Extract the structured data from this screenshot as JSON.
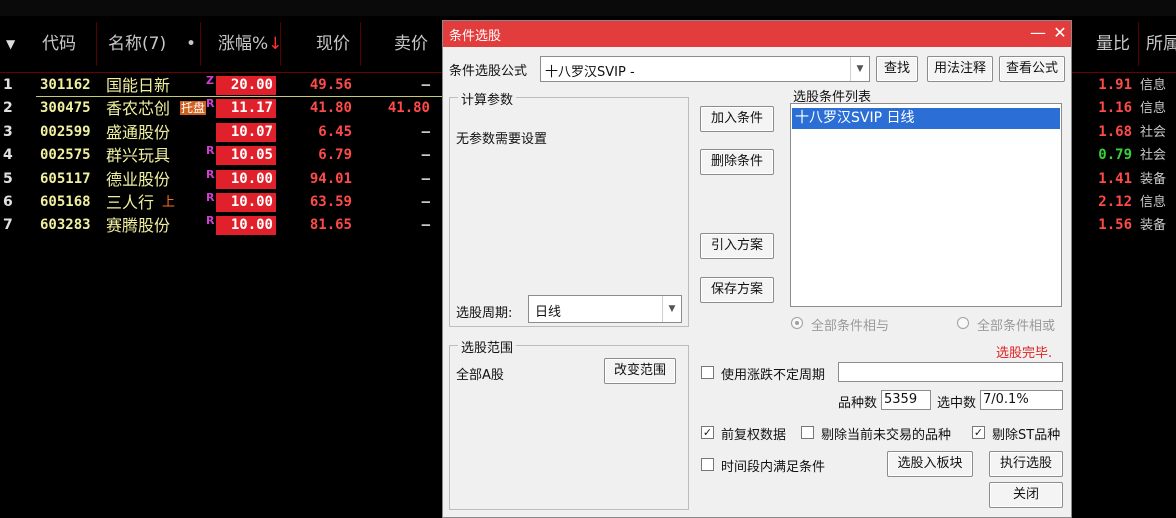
{
  "grid": {
    "headers": {
      "code": "代码",
      "name": "名称(7)",
      "dot": "•",
      "pct": "涨幅%",
      "pct_arrow": "↓",
      "price": "现价",
      "ask": "卖价",
      "vol_ratio": "量比",
      "industry": "所属"
    },
    "rows": [
      {
        "n": "1",
        "code": "301162",
        "name": "国能日新",
        "mark": "Z",
        "pct": "20.00",
        "price": "49.56",
        "ask": "—",
        "vr": "1.91",
        "ind": "信息"
      },
      {
        "n": "2",
        "code": "300475",
        "name": "香农芯创",
        "mark": "R",
        "tag": "托盘",
        "pct": "11.17",
        "price": "41.80",
        "ask": "41.80",
        "vr": "1.16",
        "ind": "信息"
      },
      {
        "n": "3",
        "code": "002599",
        "name": "盛通股份",
        "mark": "",
        "pct": "10.07",
        "price": "6.45",
        "ask": "—",
        "vr": "1.68",
        "ind": "社会"
      },
      {
        "n": "4",
        "code": "002575",
        "name": "群兴玩具",
        "mark": "R",
        "pct": "10.05",
        "price": "6.79",
        "ask": "—",
        "vr": "0.79",
        "ind": "社会"
      },
      {
        "n": "5",
        "code": "605117",
        "name": "德业股份",
        "mark": "R",
        "pct": "10.00",
        "price": "94.01",
        "ask": "—",
        "vr": "1.41",
        "ind": "装备"
      },
      {
        "n": "6",
        "code": "605168",
        "name": "三人行",
        "suffix": "上",
        "mark": "R",
        "pct": "10.00",
        "price": "63.59",
        "ask": "—",
        "vr": "2.12",
        "ind": "信息"
      },
      {
        "n": "7",
        "code": "603283",
        "name": "赛腾股份",
        "mark": "R",
        "pct": "10.00",
        "price": "81.65",
        "ask": "—",
        "vr": "1.56",
        "ind": "装备"
      }
    ]
  },
  "dialog": {
    "title": "条件选股",
    "minimize": "—",
    "close": "✕",
    "formula_label": "条件选股公式",
    "formula_value": "十八罗汉SVIP -",
    "find_btn": "查找",
    "usage_btn": "用法注释",
    "view_btn": "查看公式",
    "params_group": "计算参数",
    "no_params": "无参数需要设置",
    "period_label": "选股周期:",
    "period_value": "日线",
    "add_btn": "加入条件",
    "delete_btn": "删除条件",
    "import_btn": "引入方案",
    "save_btn": "保存方案",
    "cond_list_label": "选股条件列表",
    "cond_items": [
      "十八罗汉SVIP  日线"
    ],
    "radio_and": "全部条件相与",
    "radio_or": "全部条件相或",
    "status": "选股完毕.",
    "range_group": "选股范围",
    "range_value": "全部A股",
    "change_range_btn": "改变范围",
    "use_var_period": "使用涨跌不定周期",
    "count_label": "品种数",
    "count_value": "5359",
    "selected_label": "选中数",
    "selected_value": "7/0.1%",
    "chk_forward": "前复权数据",
    "chk_no_trade": "剔除当前未交易的品种",
    "chk_st": "剔除ST品种",
    "chk_period": "时间段内满足条件",
    "to_block_btn": "选股入板块",
    "run_btn": "执行选股",
    "close_btn": "关闭"
  },
  "colors": {
    "title_bar": "#e33c3c",
    "up": "#ff4a4a",
    "down": "#3ad23a",
    "pct_bg": "#e0202a",
    "selected": "#2b6fd6"
  },
  "icons": {
    "dropdown": "chevron-down-icon",
    "check": "check-icon"
  }
}
